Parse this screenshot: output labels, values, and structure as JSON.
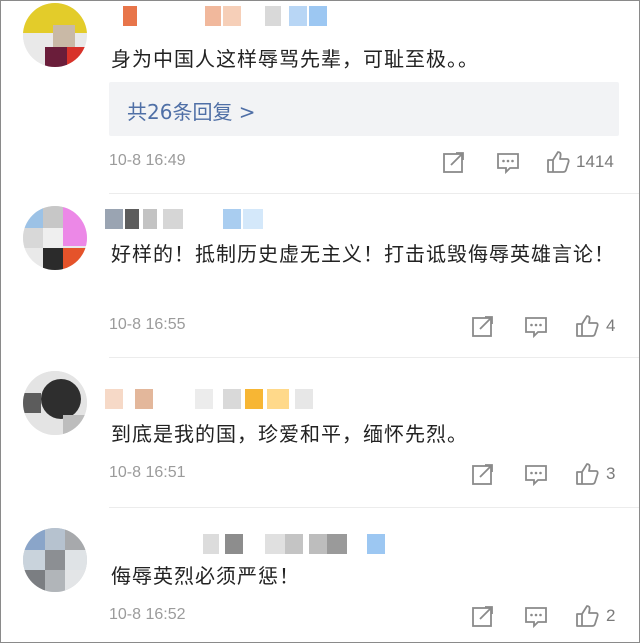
{
  "comments": [
    {
      "text": "身为中国人这样辱骂先辈，可耻至极。。",
      "replies_label": "共26条回复 >",
      "time": "10-8 16:49",
      "likes": "1414"
    },
    {
      "text": "好样的！抵制历史虚无主义！打击诋毁侮辱英雄言论！",
      "time": "10-8 16:55",
      "likes": "4"
    },
    {
      "text": "到底是我的国，珍爱和平，缅怀先烈。",
      "time": "10-8 16:51",
      "likes": "3"
    },
    {
      "text": "侮辱英烈必须严惩！",
      "time": "10-8 16:52",
      "likes": "2"
    }
  ],
  "icons": {
    "share": "share-icon",
    "comment": "comment-icon",
    "like": "thumbs-up-icon"
  },
  "colors": {
    "reply_link": "#4f6fa6",
    "meta_text": "#9b9b9b",
    "body_text": "#222222"
  }
}
